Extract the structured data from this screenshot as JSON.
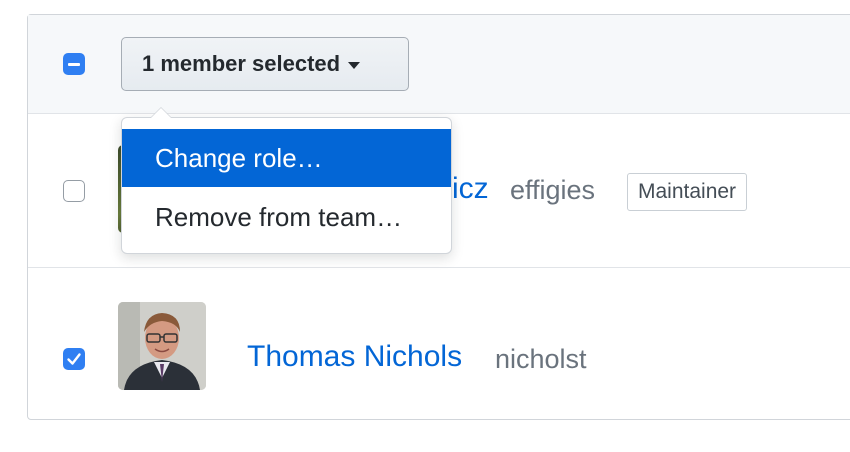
{
  "toolbar": {
    "selection_label": "1 member selected",
    "selection_state": "mixed"
  },
  "menu": {
    "items": [
      {
        "label": "Change role…",
        "highlighted": true
      },
      {
        "label": "Remove from team…",
        "highlighted": false
      }
    ]
  },
  "members": [
    {
      "name_visible_fragment": "icz",
      "login": "effigies",
      "role": "Maintainer",
      "checked": false
    },
    {
      "name": "Thomas Nichols",
      "login": "nicholst",
      "role": "",
      "checked": true
    }
  ],
  "colors": {
    "accent": "#0366d6",
    "checkbox": "#2f7ff2",
    "muted_text": "#6a737d"
  }
}
